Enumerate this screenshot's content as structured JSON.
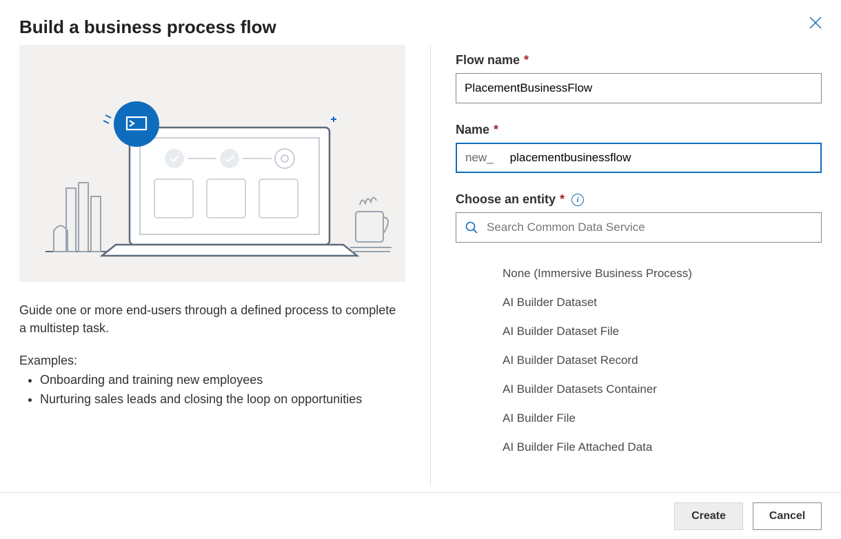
{
  "title": "Build a business process flow",
  "description": "Guide one or more end-users through a defined process to complete a multistep task.",
  "examples_label": "Examples:",
  "examples": [
    "Onboarding and training new employees",
    "Nurturing sales leads and closing the loop on opportunities"
  ],
  "fields": {
    "flow_name": {
      "label": "Flow name",
      "value": "PlacementBusinessFlow"
    },
    "name": {
      "label": "Name",
      "prefix": "new_",
      "value": "placementbusinessflow"
    },
    "entity": {
      "label": "Choose an entity",
      "search_placeholder": "Search Common Data Service"
    }
  },
  "entities": [
    "None (Immersive Business Process)",
    "AI Builder Dataset",
    "AI Builder Dataset File",
    "AI Builder Dataset Record",
    "AI Builder Datasets Container",
    "AI Builder File",
    "AI Builder File Attached Data"
  ],
  "buttons": {
    "create": "Create",
    "cancel": "Cancel"
  }
}
